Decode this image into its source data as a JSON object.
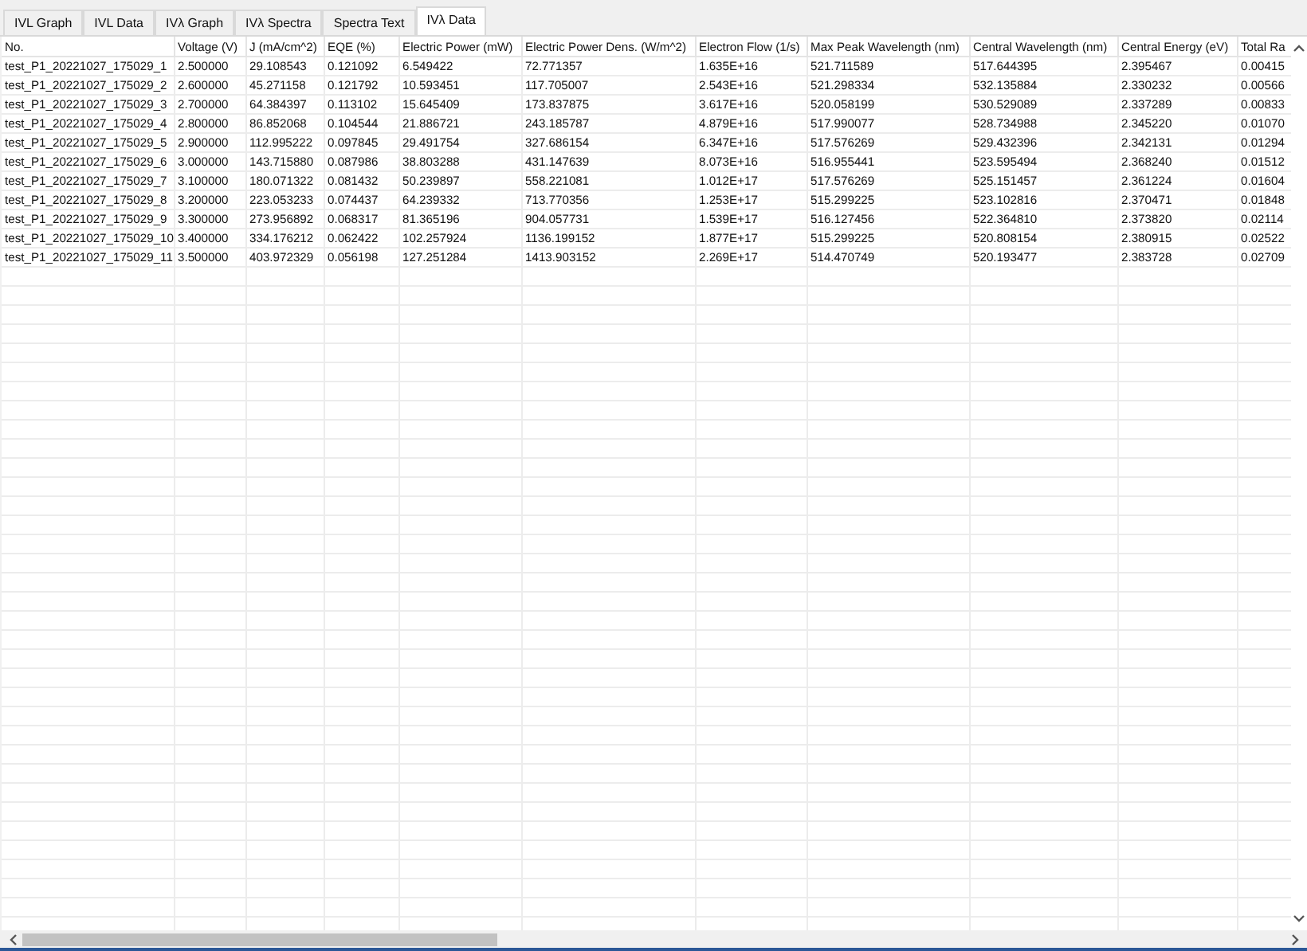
{
  "tabs": [
    {
      "label": "IVL Graph",
      "selected": false
    },
    {
      "label": "IVL Data",
      "selected": false
    },
    {
      "label": "IVλ Graph",
      "selected": false
    },
    {
      "label": "IVλ Spectra",
      "selected": false
    },
    {
      "label": "Spectra Text",
      "selected": false
    },
    {
      "label": "IVλ Data",
      "selected": true
    }
  ],
  "table": {
    "columns": [
      "No.",
      "Voltage (V)",
      "J (mA/cm^2)",
      "EQE (%)",
      "Electric Power (mW)",
      "Electric Power Dens. (W/m^2)",
      "Electron Flow (1/s)",
      "Max Peak Wavelength (nm)",
      "Central Wavelength (nm)",
      "Central Energy (eV)",
      "Total Ra"
    ],
    "rows": [
      [
        "test_P1_20221027_175029_1",
        "2.500000",
        "29.108543",
        "0.121092",
        "6.549422",
        "72.771357",
        "1.635E+16",
        "521.711589",
        "517.644395",
        "2.395467",
        "0.00415"
      ],
      [
        "test_P1_20221027_175029_2",
        "2.600000",
        "45.271158",
        "0.121792",
        "10.593451",
        "117.705007",
        "2.543E+16",
        "521.298334",
        "532.135884",
        "2.330232",
        "0.00566"
      ],
      [
        "test_P1_20221027_175029_3",
        "2.700000",
        "64.384397",
        "0.113102",
        "15.645409",
        "173.837875",
        "3.617E+16",
        "520.058199",
        "530.529089",
        "2.337289",
        "0.00833"
      ],
      [
        "test_P1_20221027_175029_4",
        "2.800000",
        "86.852068",
        "0.104544",
        "21.886721",
        "243.185787",
        "4.879E+16",
        "517.990077",
        "528.734988",
        "2.345220",
        "0.01070"
      ],
      [
        "test_P1_20221027_175029_5",
        "2.900000",
        "112.995222",
        "0.097845",
        "29.491754",
        "327.686154",
        "6.347E+16",
        "517.576269",
        "529.432396",
        "2.342131",
        "0.01294"
      ],
      [
        "test_P1_20221027_175029_6",
        "3.000000",
        "143.715880",
        "0.087986",
        "38.803288",
        "431.147639",
        "8.073E+16",
        "516.955441",
        "523.595494",
        "2.368240",
        "0.01512"
      ],
      [
        "test_P1_20221027_175029_7",
        "3.100000",
        "180.071322",
        "0.081432",
        "50.239897",
        "558.221081",
        "1.012E+17",
        "517.576269",
        "525.151457",
        "2.361224",
        "0.01604"
      ],
      [
        "test_P1_20221027_175029_8",
        "3.200000",
        "223.053233",
        "0.074437",
        "64.239332",
        "713.770356",
        "1.253E+17",
        "515.299225",
        "523.102816",
        "2.370471",
        "0.01848"
      ],
      [
        "test_P1_20221027_175029_9",
        "3.300000",
        "273.956892",
        "0.068317",
        "81.365196",
        "904.057731",
        "1.539E+17",
        "516.127456",
        "522.364810",
        "2.373820",
        "0.02114"
      ],
      [
        "test_P1_20221027_175029_10",
        "3.400000",
        "334.176212",
        "0.062422",
        "102.257924",
        "1136.199152",
        "1.877E+17",
        "515.299225",
        "520.808154",
        "2.380915",
        "0.02522"
      ],
      [
        "test_P1_20221027_175029_11",
        "3.500000",
        "403.972329",
        "0.056198",
        "127.251284",
        "1413.903152",
        "2.269E+17",
        "514.470749",
        "520.193477",
        "2.383728",
        "0.02709"
      ]
    ]
  }
}
